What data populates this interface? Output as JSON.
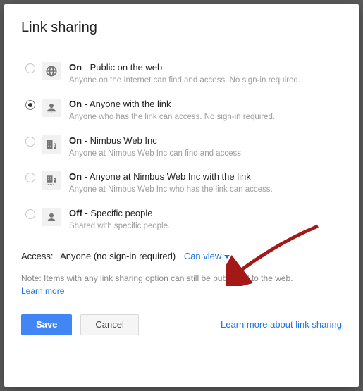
{
  "title": "Link sharing",
  "options": [
    {
      "prefix": "On",
      "label": "Public on the web",
      "desc": "Anyone on the Internet can find and access. No sign-in required.",
      "selected": false
    },
    {
      "prefix": "On",
      "label": "Anyone with the link",
      "desc": "Anyone who has the link can access. No sign-in required.",
      "selected": true
    },
    {
      "prefix": "On",
      "label": "Nimbus Web Inc",
      "desc": "Anyone at Nimbus Web Inc can find and access.",
      "selected": false
    },
    {
      "prefix": "On",
      "label": "Anyone at Nimbus Web Inc with the link",
      "desc": "Anyone at Nimbus Web Inc who has the link can access.",
      "selected": false
    },
    {
      "prefix": "Off",
      "label": "Specific people",
      "desc": "Shared with specific people.",
      "selected": false
    }
  ],
  "access": {
    "label": "Access:",
    "value": "Anyone (no sign-in required)",
    "permission": "Can view"
  },
  "note": "Note: Items with any link sharing option can still be published to the web.",
  "learn_more_small": "Learn more",
  "buttons": {
    "save": "Save",
    "cancel": "Cancel"
  },
  "learn_more_link": "Learn more about link sharing"
}
